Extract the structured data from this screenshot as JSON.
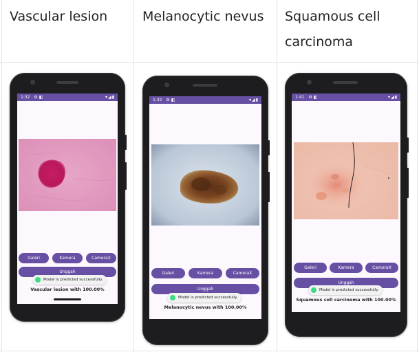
{
  "columns": [
    {
      "header": "Vascular lesion",
      "status_time": "1:32",
      "buttons": [
        "Galeri",
        "Kamera",
        "CameraX"
      ],
      "upload_label": "Unggah",
      "toast": "Model is predicted successfully.",
      "result": "Vascular lesion with 100.00%"
    },
    {
      "header": "Melanocytic nevus",
      "status_time": "1:32",
      "buttons": [
        "Galeri",
        "Kamera",
        "CameraX"
      ],
      "upload_label": "Unggah",
      "toast": "Model is predicted successfully.",
      "result": "Melanocytic nevus with 100.00%"
    },
    {
      "header": "Squamous cell carcinoma",
      "status_time": "1:41",
      "buttons": [
        "Galeri",
        "Kamera",
        "CameraX"
      ],
      "upload_label": "Unggah",
      "toast": "Model is predicted successfully.",
      "result": "Squamous cell carcinoma with 100.00%"
    }
  ],
  "colors": {
    "accent": "#6750a4",
    "screen_bg": "#fdf7fe",
    "phone_body": "#1d1d1f",
    "toast_icon": "#3ddc84"
  },
  "icons": [
    "camera-icon",
    "speaker-icon",
    "wifi-icon",
    "signal-icon",
    "battery-icon",
    "android-icon"
  ]
}
